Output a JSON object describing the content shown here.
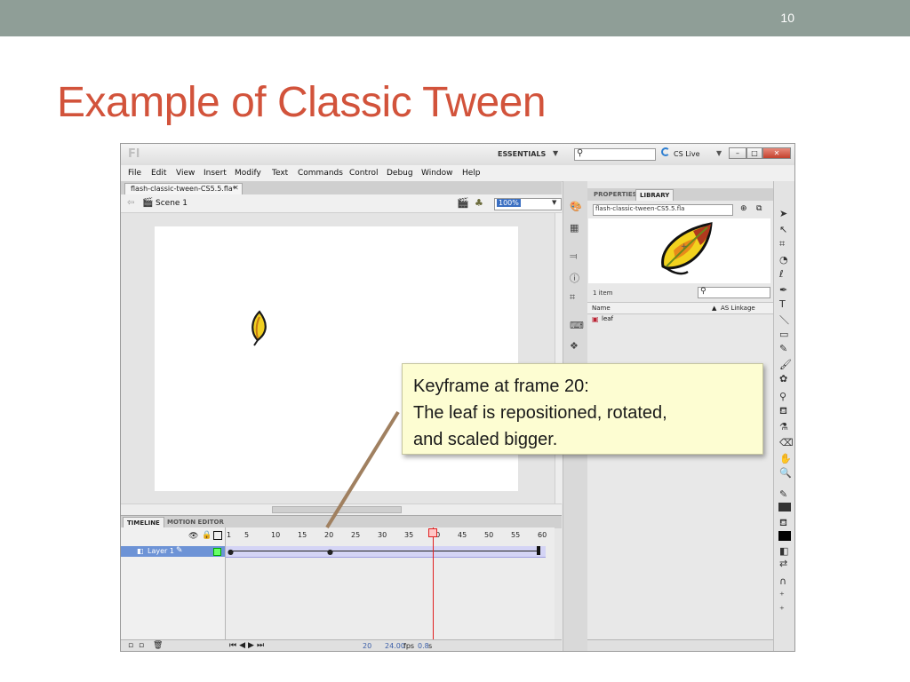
{
  "slide": {
    "number": "10",
    "title": "Example of Classic Tween"
  },
  "app": {
    "logo": "Fl",
    "workspace": "ESSENTIALS",
    "cs_live": "CS Live",
    "menu": [
      "File",
      "Edit",
      "View",
      "Insert",
      "Modify",
      "Text",
      "Commands",
      "Control",
      "Debug",
      "Window",
      "Help"
    ],
    "document_tab": "flash-classic-tween-CS5.5.fla*",
    "scene": "Scene 1",
    "zoom": "100%",
    "timeline_tabs": [
      "TIMELINE",
      "MOTION EDITOR"
    ],
    "layer_name": "Layer 1",
    "frame_numbers": [
      "1",
      "5",
      "10",
      "15",
      "20",
      "25",
      "30",
      "35",
      "40",
      "45",
      "50",
      "55",
      "60"
    ],
    "current_frame": "20",
    "fps": "24.00",
    "fps_unit": "fps",
    "seconds": "0.8",
    "seconds_unit": "s"
  },
  "library": {
    "tabs": [
      "PROPERTIES",
      "LIBRARY"
    ],
    "document": "flash-classic-tween-CS5.5.fla",
    "count": "1 item",
    "col_name": "Name",
    "col_linkage": "AS Linkage",
    "items": [
      "leaf"
    ]
  },
  "callout": {
    "line1": "Keyframe at frame 20:",
    "line2": "The leaf is repositioned, rotated,",
    "line3": "and scaled bigger."
  },
  "colors": {
    "title": "#d2533b",
    "topbar": "#8f9e97",
    "callout_bg": "#fdfdd2",
    "playhead": "#e02020"
  }
}
